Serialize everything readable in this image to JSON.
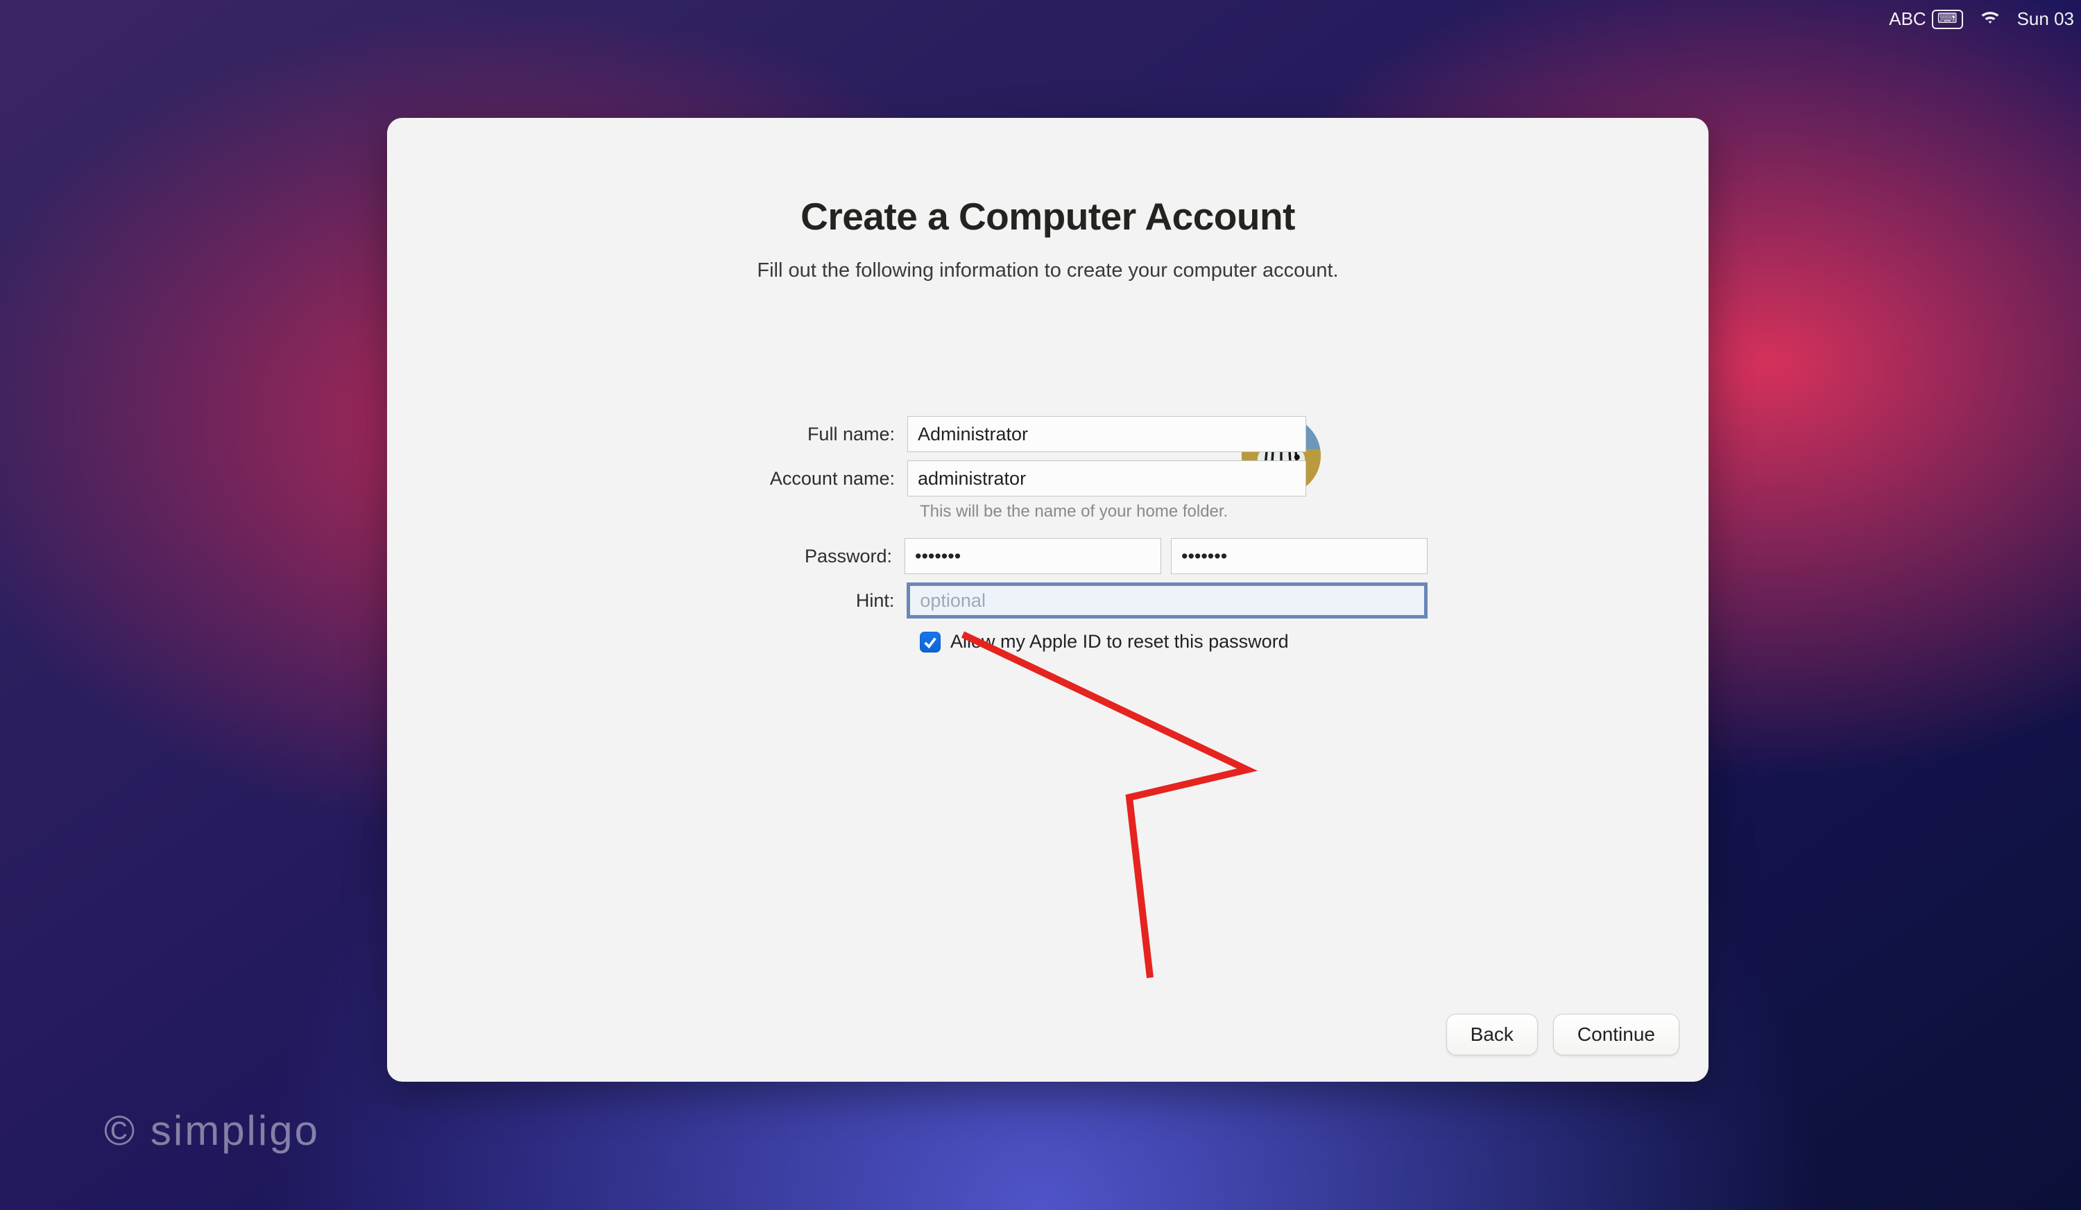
{
  "menubar": {
    "input_source": "ABC",
    "clock": "Sun 03"
  },
  "panel": {
    "title": "Create a Computer Account",
    "subtitle": "Fill out the following information to create your computer account.",
    "form": {
      "full_name_label": "Full name:",
      "full_name_value": "Administrator",
      "account_name_label": "Account name:",
      "account_name_value": "administrator",
      "account_name_hint": "This will be the name of your home folder.",
      "password_label": "Password:",
      "password_value": "•••••••",
      "password_verify_value": "•••••••",
      "hint_label": "Hint:",
      "hint_value": "",
      "hint_placeholder": "optional",
      "apple_id_checkbox_label": "Allow my Apple ID to reset this password",
      "apple_id_checkbox_checked": true
    },
    "buttons": {
      "back": "Back",
      "continue": "Continue"
    },
    "avatar_name": "zebra-avatar"
  },
  "watermark": "© simpligo"
}
